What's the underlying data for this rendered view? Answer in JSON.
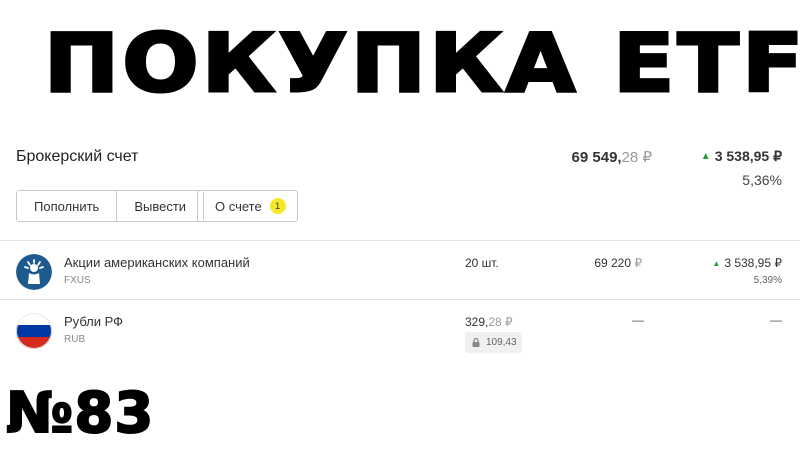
{
  "headline": "ПОКУПКА ETF",
  "episode": "№83",
  "account": {
    "title": "Брокерский счет",
    "total_main": "69 549,",
    "total_dec": "28 ₽",
    "change": "3 538,95 ₽",
    "change_pct": "5,36%"
  },
  "buttons": {
    "deposit": "Пополнить",
    "withdraw": "Вывести",
    "about": "О счете",
    "about_badge": "1"
  },
  "holdings": [
    {
      "name": "Акции американских компаний",
      "code": "FXUS",
      "icon": "statue-of-liberty-icon",
      "qty": "20 шт.",
      "value_main": "69 220 ",
      "value_cur": "₽",
      "change": "3 538,95 ₽",
      "change_pct": "5,39%"
    },
    {
      "name": "Рубли РФ",
      "code": "RUB",
      "icon": "russian-flag-icon",
      "qty_main": "329,",
      "qty_dec": "28 ₽",
      "blocked": "109,43",
      "value": "—",
      "change": "—"
    }
  ],
  "colors": {
    "positive": "#21a038",
    "badge": "#f5e82c",
    "fxus_icon": "#1e5a8e",
    "flag_red": "#d52b1e",
    "flag_blue": "#0039a6"
  }
}
